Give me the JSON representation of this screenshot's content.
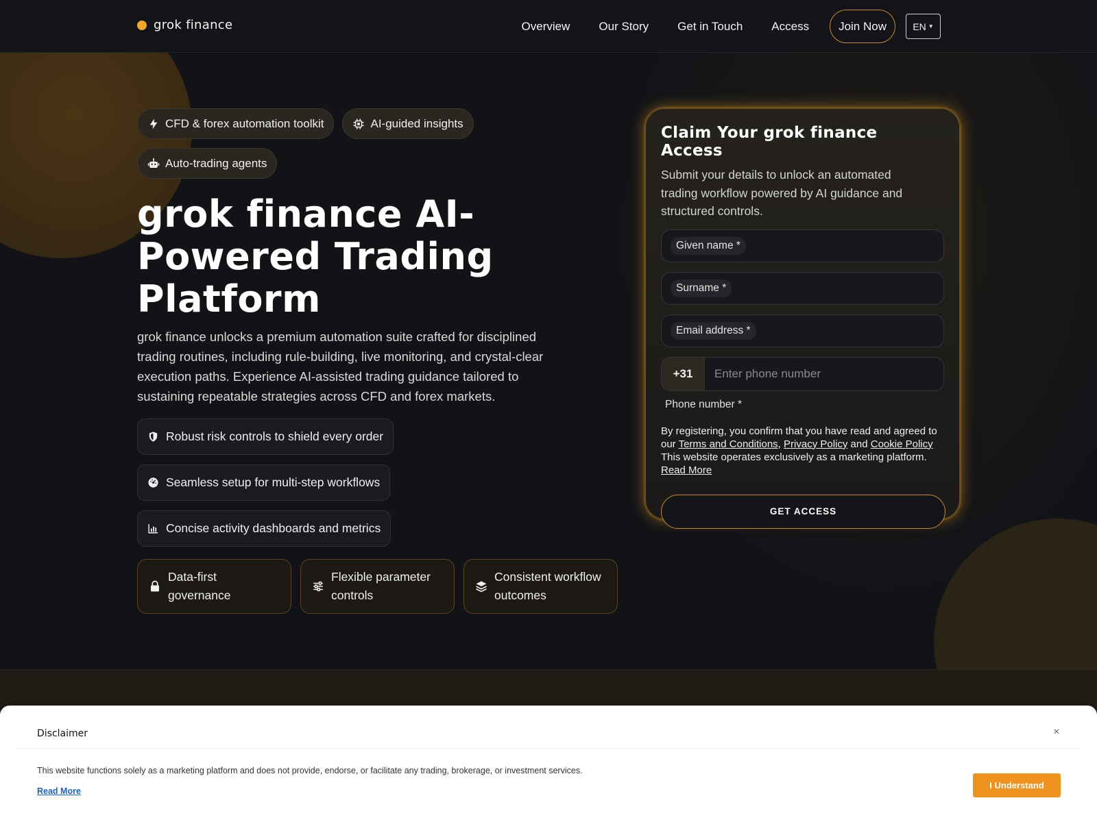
{
  "header": {
    "logo_text": "grok finance",
    "nav": [
      "Overview",
      "Our Story",
      "Get in Touch",
      "Access"
    ],
    "join_label": "Join Now",
    "lang_label": "EN"
  },
  "colors": {
    "accent": "#f5a623",
    "background": "#111317",
    "button_orange": "#f0921e"
  },
  "hero": {
    "tags": [
      {
        "label": "CFD & forex automation toolkit",
        "icon": "bolt-icon"
      },
      {
        "label": "AI-guided insights",
        "icon": "chip-icon"
      },
      {
        "label": "Auto-trading agents",
        "icon": "robot-icon"
      }
    ],
    "title": "grok finance AI-Powered Trading Platform",
    "description": "grok finance unlocks a premium automation suite crafted for disciplined trading routines, including rule-building, live monitoring, and crystal-clear execution paths. Experience AI-assisted trading guidance tailored to sustaining repeatable strategies across CFD and forex markets.",
    "features": [
      {
        "label": "Robust risk controls to shield every order",
        "icon": "shield-icon"
      },
      {
        "label": "Seamless setup for multi-step workflows",
        "icon": "gauge-icon"
      },
      {
        "label": "Concise activity dashboards and metrics",
        "icon": "bar-chart-icon"
      }
    ],
    "cards": [
      {
        "label": "Data-first governance",
        "icon": "lock-icon"
      },
      {
        "label": "Flexible parameter controls",
        "icon": "sliders-icon"
      },
      {
        "label": "Consistent workflow outcomes",
        "icon": "layers-icon"
      }
    ]
  },
  "form": {
    "title": "Claim Your grok finance Access",
    "subtitle": "Submit your details to unlock an automated trading workflow powered by AI guidance and structured controls.",
    "given_name_label": "Given name *",
    "surname_label": "Surname *",
    "email_label": "Email address *",
    "phone_code": "+31",
    "phone_placeholder": "Enter phone number",
    "phone_label": "Phone number *",
    "consent_prefix": "By registering, you confirm that you have read and agreed to our",
    "terms_link": "Terms and Conditions",
    "privacy_link": "Privacy Policy",
    "and_word": "and",
    "cookie_link": "Cookie Policy",
    "consent_suffix": "This website operates exclusively as a marketing platform.",
    "read_more": "Read More",
    "submit_label": "GET ACCESS"
  },
  "disclaimer": {
    "title": "Disclaimer",
    "close": "×",
    "text": "This website functions solely as a marketing platform and does not provide, endorse, or facilitate any trading, brokerage, or investment services.",
    "read_more": "Read More",
    "button_label": "I Understand"
  }
}
